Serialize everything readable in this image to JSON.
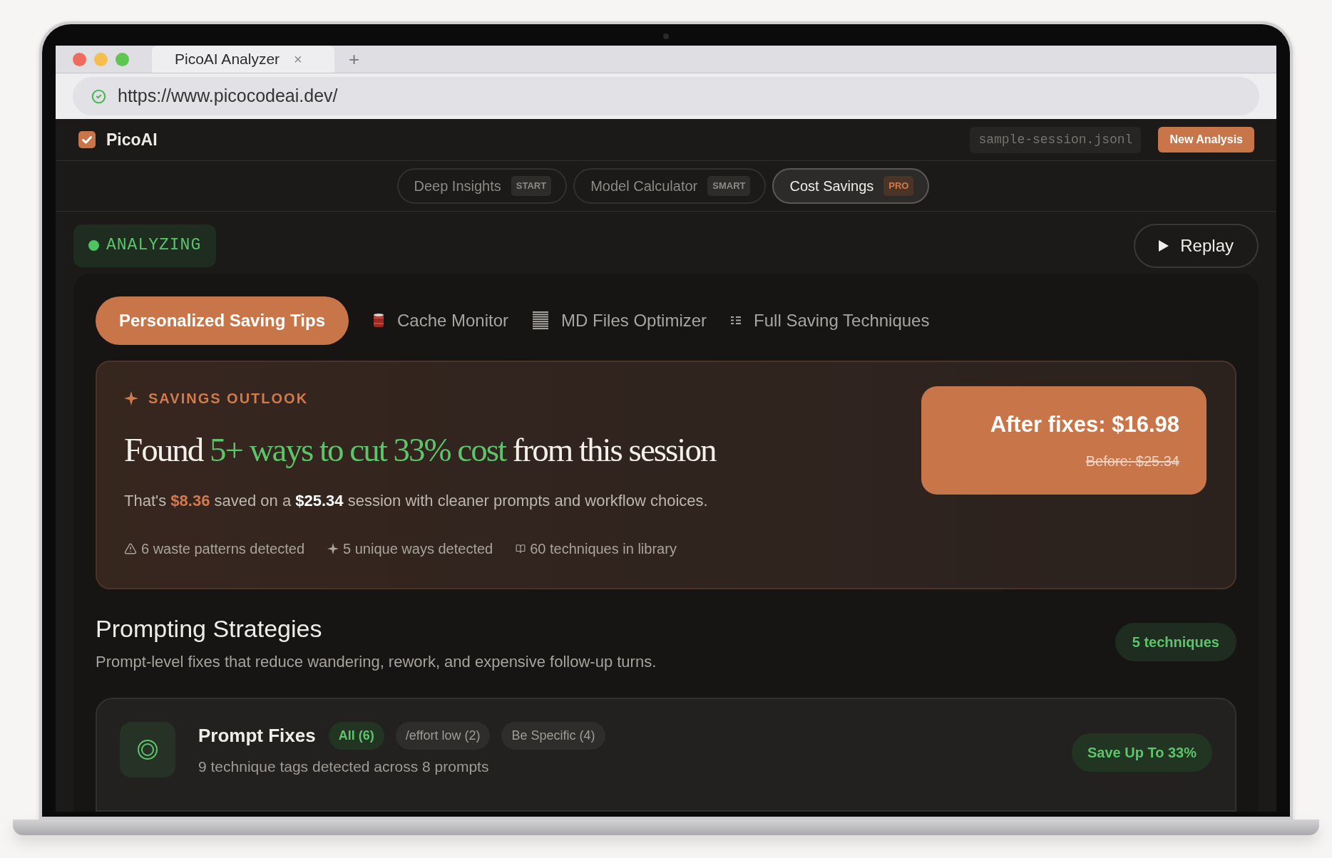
{
  "browser": {
    "tab_title": "PicoAI Analyzer",
    "close_tab": "×",
    "new_tab": "+",
    "url": "https://www.picocodeai.dev/"
  },
  "header": {
    "brand": "PicoAI",
    "file": "sample-session.jsonl",
    "new_button": "New Analysis"
  },
  "modes": [
    {
      "label": "Deep Insights",
      "badge": "START",
      "selected": false
    },
    {
      "label": "Model Calculator",
      "badge": "SMART",
      "selected": false
    },
    {
      "label": "Cost Savings",
      "badge": "PRO",
      "selected": true
    }
  ],
  "status": {
    "label": "ANALYZING"
  },
  "replay": {
    "label": "Replay"
  },
  "subtabs": [
    {
      "label": "Personalized Saving Tips",
      "kind": "plain",
      "selected": true
    },
    {
      "label": "Cache Monitor",
      "kind": "cache",
      "selected": false
    },
    {
      "label": "MD Files Optimizer",
      "kind": "document",
      "selected": false
    },
    {
      "label": "Full Saving Techniques",
      "kind": "list",
      "selected": false
    }
  ],
  "outlook": {
    "eyebrow": "SAVINGS OUTLOOK",
    "headline": [
      {
        "text": "Found ",
        "accent": false
      },
      {
        "text": "5+ ways to cut 33% cost",
        "accent": true
      },
      {
        "text": " from this session",
        "accent": false
      }
    ],
    "summary": [
      {
        "text": "That's ",
        "kind": "plain"
      },
      {
        "text": "$8.36",
        "kind": "saving"
      },
      {
        "text": " saved on a ",
        "kind": "plain"
      },
      {
        "text": "$25.34",
        "kind": "strong"
      },
      {
        "text": " session with cleaner prompts and workflow choices.",
        "kind": "plain"
      }
    ],
    "stats": [
      {
        "kind": "warning",
        "text": "6 waste patterns detected"
      },
      {
        "kind": "sparkle",
        "text": "5 unique ways detected"
      },
      {
        "kind": "book",
        "text": "60 techniques in library"
      }
    ],
    "after": "After fixes: $16.98",
    "before": "Before: $25.34"
  },
  "section": {
    "title": "Prompting Strategies",
    "subtitle": "Prompt-level fixes that reduce wandering, rework, and expensive follow-up turns.",
    "count": "5 techniques"
  },
  "card": {
    "title": "Prompt Fixes",
    "filters": [
      {
        "label": "All (6)",
        "selected": true
      },
      {
        "label": "/effort low (2)",
        "selected": false
      },
      {
        "label": "Be Specific (4)",
        "selected": false
      }
    ],
    "subtitle": "9 technique tags detected across 8 prompts",
    "save": "Save Up To 33%"
  }
}
